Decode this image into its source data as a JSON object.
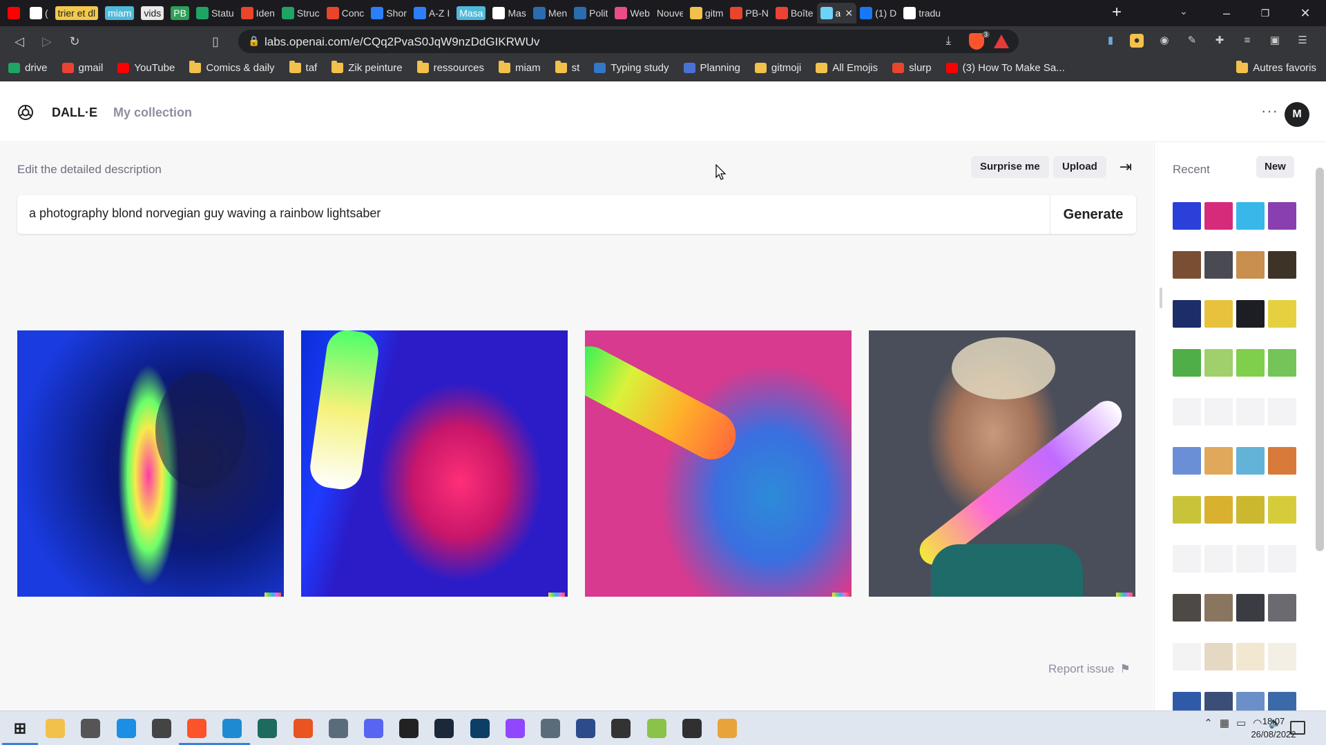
{
  "browser": {
    "tabs": [
      {
        "title": "",
        "icon": "youtube-icon",
        "color": "#ff0000"
      },
      {
        "title": "(",
        "icon": "mute-icon",
        "color": "#ffffff"
      },
      {
        "title": "trier et dl",
        "pill": "yellow"
      },
      {
        "title": "miam",
        "pill": "blue"
      },
      {
        "title": "vids",
        "pill": "white"
      },
      {
        "title": "PB",
        "pill": "green"
      },
      {
        "title": "Statu",
        "icon": "sheets-icon",
        "color": "#1fa463"
      },
      {
        "title": "Iden",
        "icon": "notion-icon",
        "color": "#e8452c"
      },
      {
        "title": "Struc",
        "icon": "sheets-icon",
        "color": "#1fa463"
      },
      {
        "title": "Conc",
        "icon": "drawio-icon",
        "color": "#e8452c"
      },
      {
        "title": "Shor",
        "icon": "keep-icon",
        "color": "#2d7ff9"
      },
      {
        "title": "A-Z I",
        "icon": "keep-icon",
        "color": "#2d7ff9"
      },
      {
        "title": "Masa",
        "pill": "blue"
      },
      {
        "title": "Mas",
        "icon": "notion-icon",
        "color": "#ffffff"
      },
      {
        "title": "Men",
        "icon": "wordpress-icon",
        "color": "#2b6cb0"
      },
      {
        "title": "Polit",
        "icon": "wordpress-icon",
        "color": "#2b6cb0"
      },
      {
        "title": "Web",
        "icon": "dribbble-icon",
        "color": "#ea4c89"
      },
      {
        "title": "Nouvel o",
        "icon": "",
        "color": ""
      },
      {
        "title": "gitm",
        "icon": "emoji-icon",
        "color": "#f2c14b"
      },
      {
        "title": "PB-N",
        "icon": "drawio-icon",
        "color": "#e8452c"
      },
      {
        "title": "Boîte",
        "icon": "gmail-icon",
        "color": "#ea4335"
      },
      {
        "title": "a",
        "icon": "dalle-icon",
        "color": "#6fd3f7",
        "active": true
      },
      {
        "title": "(1) D",
        "icon": "facebook-icon",
        "color": "#1877f2"
      },
      {
        "title": "tradu",
        "icon": "google-icon",
        "color": "#ffffff"
      }
    ],
    "new_tab": "+",
    "url": "labs.openai.com/e/CQq2PvaS0JqW9nzDdGIKRWUv",
    "shield_count": "3",
    "bookmarks": [
      {
        "label": "drive",
        "icon": "drive-icon",
        "color": "#1fa463"
      },
      {
        "label": "gmail",
        "icon": "gmail-icon",
        "color": "#ea4335"
      },
      {
        "label": "YouTube",
        "icon": "youtube-icon",
        "color": "#ff0000"
      },
      {
        "label": "Comics & daily",
        "icon": "folder-icon",
        "color": "#f2c14b"
      },
      {
        "label": "taf",
        "icon": "folder-icon",
        "color": "#f2c14b"
      },
      {
        "label": "Zik peinture",
        "icon": "folder-icon",
        "color": "#f2c14b"
      },
      {
        "label": "ressources",
        "icon": "folder-icon",
        "color": "#f2c14b"
      },
      {
        "label": "miam",
        "icon": "folder-icon",
        "color": "#f2c14b"
      },
      {
        "label": "st",
        "icon": "folder-icon",
        "color": "#f2c14b"
      },
      {
        "label": "Typing study",
        "icon": "typescript-icon",
        "color": "#3178c6"
      },
      {
        "label": "Planning",
        "icon": "calendar-icon",
        "color": "#4a72d6"
      },
      {
        "label": "gitmoji",
        "icon": "emoji-icon",
        "color": "#f2c14b"
      },
      {
        "label": "All Emojis",
        "icon": "smiley-icon",
        "color": "#f2c14b"
      },
      {
        "label": "slurp",
        "icon": "slurp-icon",
        "color": "#e8452c"
      },
      {
        "label": "(3) How To Make Sa...",
        "icon": "youtube-icon",
        "color": "#ff0000"
      }
    ],
    "other_bookmarks": "Autres favoris"
  },
  "app": {
    "name": "DALL·E",
    "collection": "My collection",
    "avatar_initial": "M",
    "more": "···"
  },
  "editor": {
    "label": "Edit the detailed description",
    "surprise": "Surprise me",
    "upload": "Upload",
    "prompt": "a photography blond norvegian guy waving a rainbow lightsaber",
    "generate": "Generate",
    "report": "Report issue"
  },
  "sidebar": {
    "recent": "Recent",
    "new": "New",
    "history_rows": [
      {
        "colors": [
          "#2a40d8",
          "#d62a7a",
          "#37b8e8",
          "#8a3fb0"
        ]
      },
      {
        "colors": [
          "#7a4e33",
          "#4a4a52",
          "#c98f4e",
          "#3d3327"
        ]
      },
      {
        "colors": [
          "#1d2d6a",
          "#e8c23d",
          "#1d1d24",
          "#e5d140"
        ]
      },
      {
        "colors": [
          "#4fae47",
          "#9fd06b",
          "#7fcf4c",
          "#74c45a"
        ]
      },
      {
        "colors": [],
        "empty": true
      },
      {
        "colors": [
          "#6a8fd6",
          "#e0a85a",
          "#63b3d8",
          "#d87a3a"
        ]
      },
      {
        "colors": [
          "#c8c43a",
          "#d9b12e",
          "#cbb82f",
          "#d6cc3b"
        ]
      },
      {
        "colors": [],
        "empty": true
      },
      {
        "colors": [
          "#4d4a45",
          "#8a7560",
          "#3b3b44",
          "#6a6a70"
        ]
      },
      {
        "colors": [
          "#f3f3f3",
          "#e6d9c4",
          "#f2e7d0",
          "#f4efe4"
        ]
      },
      {
        "colors": [
          "#2f5aa8",
          "#3a4e78",
          "#6b8fc8",
          "#3c6aa8"
        ]
      }
    ]
  },
  "taskbar": {
    "apps": [
      {
        "name": "windows-start-icon",
        "color": "#0078d4"
      },
      {
        "name": "file-explorer-icon",
        "color": "#f2c14b"
      },
      {
        "name": "settings-icon",
        "color": "#555555"
      },
      {
        "name": "edge-icon",
        "color": "#1a8fe3"
      },
      {
        "name": "app-settings-icon",
        "color": "#444444"
      },
      {
        "name": "brave-icon",
        "color": "#fb542b"
      },
      {
        "name": "vscode-icon",
        "color": "#1f8ad2"
      },
      {
        "name": "gitkraken-icon",
        "color": "#1c6b5e"
      },
      {
        "name": "ubuntu-icon",
        "color": "#e95420"
      },
      {
        "name": "files-icon",
        "color": "#5a6b7a"
      },
      {
        "name": "discord-icon",
        "color": "#5865f2"
      },
      {
        "name": "epic-games-icon",
        "color": "#222222"
      },
      {
        "name": "steam-icon",
        "color": "#1b2838"
      },
      {
        "name": "photoshop-icon",
        "color": "#0c3e66"
      },
      {
        "name": "twitch-icon",
        "color": "#9146ff"
      },
      {
        "name": "notepad-icon",
        "color": "#5a6b7a"
      },
      {
        "name": "obs-circle-icon",
        "color": "#2b4b8a"
      },
      {
        "name": "skype-icon",
        "color": "#333333"
      },
      {
        "name": "android-icon",
        "color": "#8bc34a"
      },
      {
        "name": "obs-icon",
        "color": "#303030"
      },
      {
        "name": "game-icon",
        "color": "#e8a33a"
      }
    ],
    "time": "18:07",
    "date": "26/08/2022"
  }
}
